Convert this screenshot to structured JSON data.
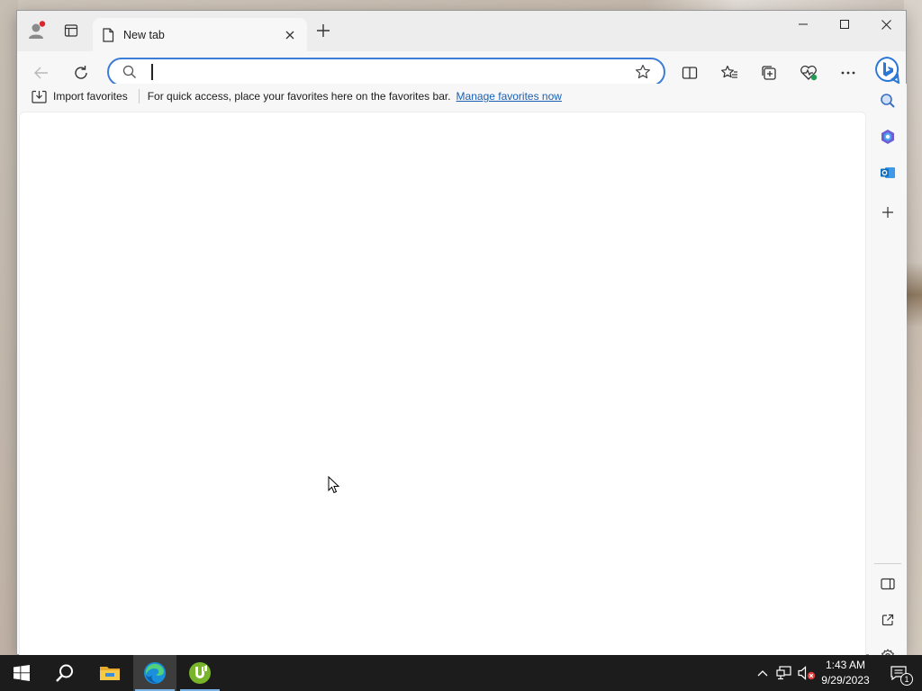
{
  "browser": {
    "tab": {
      "title": "New tab"
    },
    "addressbar": {
      "value": "",
      "placeholder": ""
    },
    "favorites_bar": {
      "import_label": "Import favorites",
      "hint": "For quick access, place your favorites here on the favorites bar.",
      "manage_link": "Manage favorites now"
    }
  },
  "taskbar": {
    "time": "1:43 AM",
    "date": "9/29/2023",
    "notification_count": "1"
  },
  "icons": {
    "titlebar": [
      "profile-icon",
      "tab-actions-icon",
      "page-icon",
      "close-icon",
      "plus-icon",
      "minimize-icon",
      "maximize-icon",
      "close-icon"
    ],
    "toolbar": [
      "back-arrow-icon",
      "refresh-icon",
      "search-icon",
      "star-icon",
      "split-screen-icon",
      "favorites-icon",
      "collections-icon",
      "browser-essentials-icon",
      "more-icon",
      "bing-icon"
    ],
    "sidebar": [
      "search-icon",
      "copilot-icon",
      "outlook-icon",
      "plus-icon",
      "hide-sidebar-icon",
      "open-external-icon",
      "settings-icon"
    ],
    "taskbar": [
      "windows-start-icon",
      "search-icon",
      "file-explorer-icon",
      "edge-icon",
      "utorrent-icon",
      "chevron-up-icon",
      "network-icon",
      "volume-muted-icon",
      "notifications-icon"
    ]
  },
  "colors": {
    "accent": "#3b7dd8",
    "link": "#1a5fb4",
    "taskbar": "#1c1c1c",
    "profile_dot": "#d9262b"
  }
}
